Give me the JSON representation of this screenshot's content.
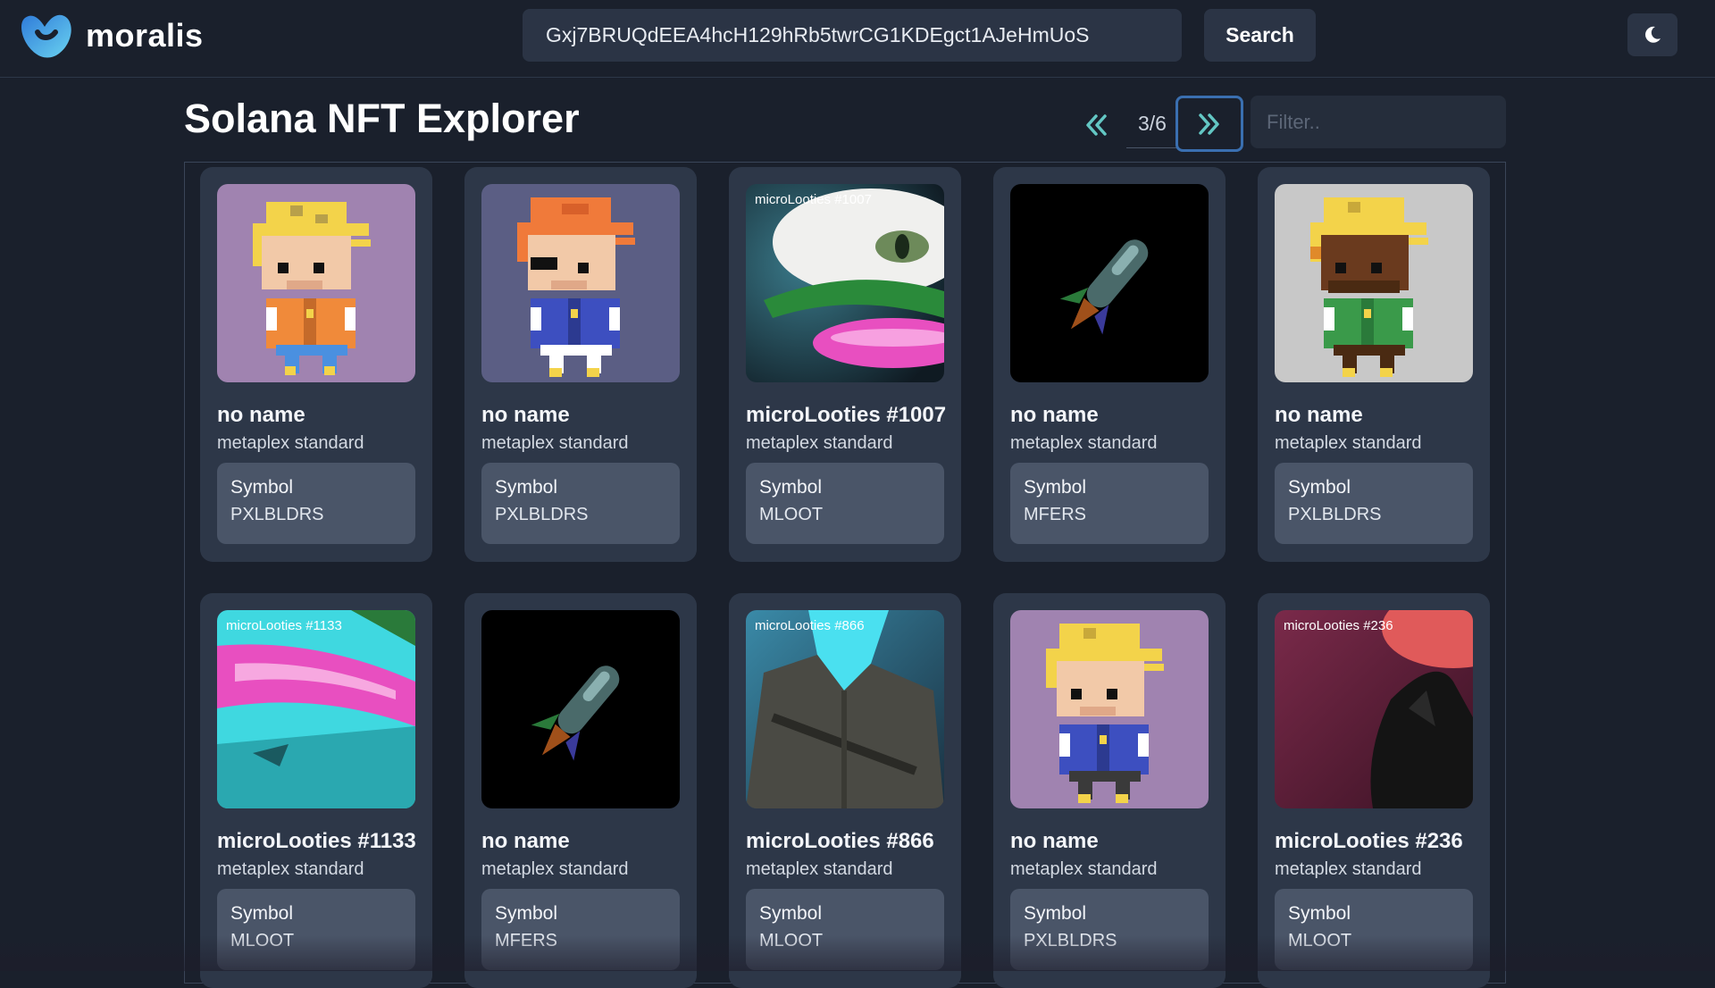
{
  "app": {
    "brand": "moralis"
  },
  "header": {
    "address_value": "Gxj7BRUQdEEA4hcH129hRb5twrCG1KDEgct1AJeHmUoS",
    "search_label": "Search",
    "theme_icon": "moon-icon"
  },
  "page": {
    "title": "Solana NFT Explorer"
  },
  "pager": {
    "current": "3/6",
    "prev_icon": "double-chevron-left-icon",
    "next_icon": "double-chevron-right-icon"
  },
  "filter": {
    "placeholder": "Filter..",
    "value": ""
  },
  "colors": {
    "background": "#1a202c",
    "card": "#2d3748",
    "symbol_box": "#4a5568",
    "accent": "#63c7c4",
    "focus": "#3a6fb0"
  },
  "cards": [
    {
      "name": "no name",
      "standard": "metaplex standard",
      "symbol_label": "Symbol",
      "symbol": "PXLBLDRS",
      "image": "pixel-builder-orange"
    },
    {
      "name": "no name",
      "standard": "metaplex standard",
      "symbol_label": "Symbol",
      "symbol": "PXLBLDRS",
      "image": "pixel-builder-blue"
    },
    {
      "name": "microLooties #1007",
      "standard": "metaplex standard",
      "symbol_label": "Symbol",
      "symbol": "MLOOT",
      "image": "microlooties-1007",
      "overlay": "microLooties #1007"
    },
    {
      "name": "no name",
      "standard": "metaplex standard",
      "symbol_label": "Symbol",
      "symbol": "MFERS",
      "image": "rocket"
    },
    {
      "name": "no name",
      "standard": "metaplex standard",
      "symbol_label": "Symbol",
      "symbol": "PXLBLDRS",
      "image": "pixel-builder-green"
    },
    {
      "name": "microLooties #1133",
      "standard": "metaplex standard",
      "symbol_label": "Symbol",
      "symbol": "MLOOT",
      "image": "microlooties-1133",
      "overlay": "microLooties #1133"
    },
    {
      "name": "no name",
      "standard": "metaplex standard",
      "symbol_label": "Symbol",
      "symbol": "MFERS",
      "image": "rocket"
    },
    {
      "name": "microLooties #866",
      "standard": "metaplex standard",
      "symbol_label": "Symbol",
      "symbol": "MLOOT",
      "image": "microlooties-866",
      "overlay": "microLooties #866"
    },
    {
      "name": "no name",
      "standard": "metaplex standard",
      "symbol_label": "Symbol",
      "symbol": "PXLBLDRS",
      "image": "pixel-builder-blue-purple"
    },
    {
      "name": "microLooties #236",
      "standard": "metaplex standard",
      "symbol_label": "Symbol",
      "symbol": "MLOOT",
      "image": "microlooties-236",
      "overlay": "microLooties #236"
    }
  ]
}
